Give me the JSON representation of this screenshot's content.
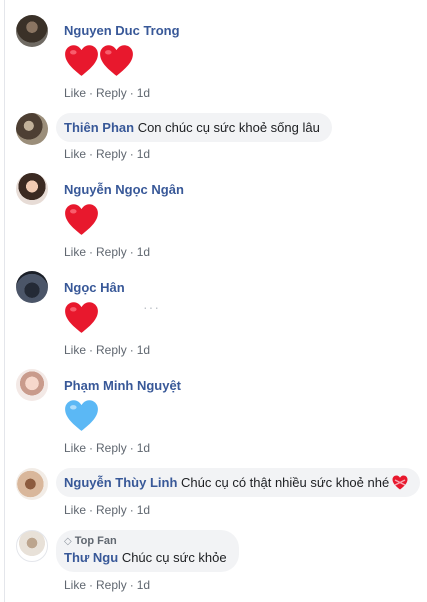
{
  "comments": [
    {
      "author": "Nguyen Duc Trong",
      "text": "",
      "reaction": "red-heart",
      "reaction_count": 2,
      "actions": {
        "like": "Like",
        "reply": "Reply",
        "time": "1d"
      }
    },
    {
      "author": "Thiên Phan",
      "text": "Con chúc cụ sức khoẻ sống lâu",
      "actions": {
        "like": "Like",
        "reply": "Reply",
        "time": "1d"
      }
    },
    {
      "author": "Nguyễn Ngọc Ngân",
      "text": "",
      "reaction": "red-heart",
      "reaction_count": 1,
      "actions": {
        "like": "Like",
        "reply": "Reply",
        "time": "1d"
      }
    },
    {
      "author": "Ngọc Hân",
      "text": "",
      "reaction": "red-heart",
      "reaction_count": 1,
      "more_options": "···",
      "actions": {
        "like": "Like",
        "reply": "Reply",
        "time": "1d"
      }
    },
    {
      "author": "Phạm Minh Nguyệt",
      "text": "",
      "reaction": "blue-heart",
      "reaction_count": 1,
      "actions": {
        "like": "Like",
        "reply": "Reply",
        "time": "1d"
      }
    },
    {
      "author": "Nguyễn Thùy Linh",
      "text": "Chúc cụ có thật nhiều sức khoẻ nhé",
      "emoji": "heart-with-ribbon",
      "actions": {
        "like": "Like",
        "reply": "Reply",
        "time": "1d"
      }
    },
    {
      "badge": "Top Fan",
      "author": "Thư Ngu",
      "text": "Chúc cụ sức khỏe",
      "actions": {
        "like": "Like",
        "reply": "Reply",
        "time": "1d"
      }
    }
  ],
  "colors": {
    "name": "#385898",
    "meta": "#606770",
    "bubble": "#f2f3f5",
    "heart_red": "#e8182d",
    "heart_blue": "#5bb8f5"
  },
  "separator": "·"
}
